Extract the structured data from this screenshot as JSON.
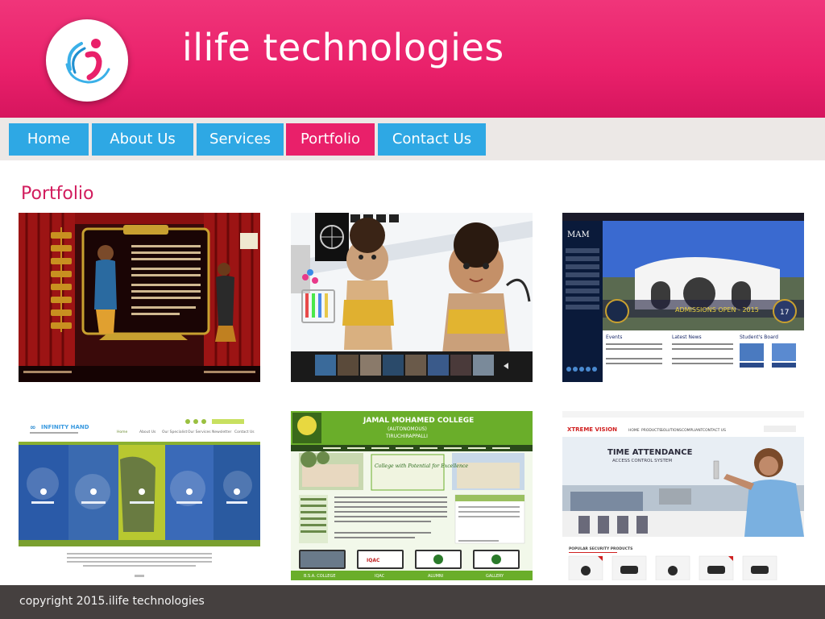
{
  "site": {
    "title": "ilife technologies",
    "logo_icon": "ilife-logo-icon",
    "colors": {
      "brand_pink": "#e9206a",
      "nav_blue": "#2ea8e4",
      "footer": "#45403f"
    }
  },
  "nav": {
    "items": [
      {
        "label": "Home",
        "active": false
      },
      {
        "label": "About Us",
        "active": false
      },
      {
        "label": "Services",
        "active": false
      },
      {
        "label": "Portfolio",
        "active": true
      },
      {
        "label": "Contact  Us",
        "active": false
      }
    ]
  },
  "portfolio": {
    "title": "Portfolio",
    "items": [
      {
        "name": "dance-academy-site"
      },
      {
        "name": "kids-photography-site"
      },
      {
        "name": "mam-engineering-college-site",
        "brand": "MAM",
        "hero_text": "ADMISSIONS OPEN - 2015",
        "badge": "17",
        "headings": [
          "Events",
          "Latest News",
          "Student's Board"
        ]
      },
      {
        "name": "infinity-hand-site",
        "brand": "INFINITY HAND",
        "nav": [
          "Home",
          "About Us",
          "Our Specialist",
          "Our Services",
          "Newsletter",
          "Contact Us"
        ]
      },
      {
        "name": "jamal-mohamed-college-site",
        "brand": "JAMAL MOHAMED COLLEGE",
        "subtitle": "(AUTONOMOUS)",
        "city": "TIRUCHIRAPPALLI",
        "banner": "College with Potential for Excellence",
        "tiles": [
          "B.S.A. COLLEGE",
          "IQAC",
          "ALUMNI",
          "GALLERY"
        ]
      },
      {
        "name": "xtreme-vision-site",
        "brand": "XTREME VISION",
        "hero_title": "TIME ATTENDANCE",
        "hero_subtitle": "ACCESS CONTROL SYSTEM",
        "nav": [
          "HOME",
          "PRODUCTS",
          "SOLUTIONS",
          "COMPLIANT",
          "CONTACT US"
        ],
        "products_heading": "POPULAR SECURITY PRODUCTS"
      }
    ]
  },
  "footer": {
    "copyright": "copyright 2015.ilife technologies"
  }
}
